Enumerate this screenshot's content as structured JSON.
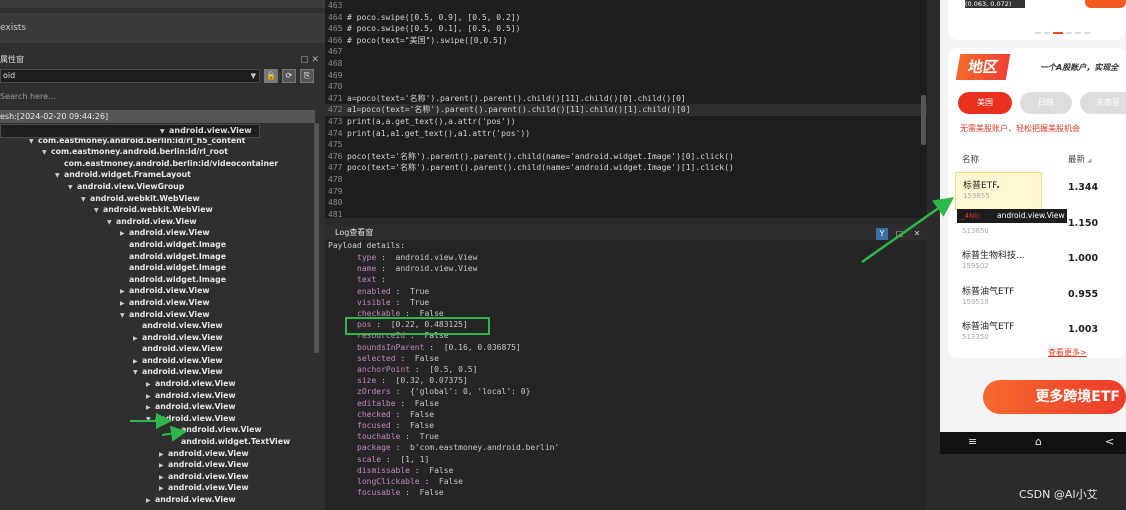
{
  "left": {
    "exists_label": "exists",
    "panel_title": "属性窗",
    "header_buttons": "▢ ✕",
    "device_select": "oid",
    "toolbar_buttons": [
      "🔒",
      "⟳",
      "⎘"
    ],
    "search_placeholder": "Search here...",
    "refresh_label": "esh:[2024-02-20 09:44:26]",
    "tree": [
      {
        "label": "android:id/content",
        "indent": 16,
        "expand": "open"
      },
      {
        "label": "com.eastmoney.android.berlin:id/rl_h5_content",
        "indent": 29,
        "expand": "open"
      },
      {
        "label": "com.eastmoney.android.berlin:id/rl_root",
        "indent": 42,
        "expand": "open"
      },
      {
        "label": "com.eastmoney.android.berlin:id/videocontainer",
        "indent": 55,
        "expand": "none"
      },
      {
        "label": "android.widget.FrameLayout",
        "indent": 55,
        "expand": "open"
      },
      {
        "label": "android.view.ViewGroup",
        "indent": 68,
        "expand": "open"
      },
      {
        "label": "android.webkit.WebView",
        "indent": 81,
        "expand": "open"
      },
      {
        "label": "android.webkit.WebView",
        "indent": 94,
        "expand": "open"
      },
      {
        "label": "android.view.View",
        "indent": 107,
        "expand": "open"
      },
      {
        "label": "android.view.View",
        "indent": 120,
        "expand": "closed"
      },
      {
        "label": "android.widget.Image",
        "indent": 120,
        "expand": "none"
      },
      {
        "label": "android.widget.Image",
        "indent": 120,
        "expand": "none"
      },
      {
        "label": "android.widget.Image",
        "indent": 120,
        "expand": "none"
      },
      {
        "label": "android.widget.Image",
        "indent": 120,
        "expand": "none"
      },
      {
        "label": "android.view.View",
        "indent": 120,
        "expand": "closed"
      },
      {
        "label": "android.view.View",
        "indent": 120,
        "expand": "closed"
      },
      {
        "label": "android.view.View",
        "indent": 120,
        "expand": "open"
      },
      {
        "label": "android.view.View",
        "indent": 133,
        "expand": "none"
      },
      {
        "label": "android.view.View",
        "indent": 133,
        "expand": "closed"
      },
      {
        "label": "android.view.View",
        "indent": 133,
        "expand": "none"
      },
      {
        "label": "android.view.View",
        "indent": 133,
        "expand": "closed"
      },
      {
        "label": "android.view.View",
        "indent": 133,
        "expand": "open"
      },
      {
        "label": "android.view.View",
        "indent": 146,
        "expand": "closed"
      },
      {
        "label": "android.view.View",
        "indent": 146,
        "expand": "closed"
      },
      {
        "label": "android.view.View",
        "indent": 146,
        "expand": "closed"
      },
      {
        "label": "android.view.View",
        "indent": 146,
        "expand": "open"
      },
      {
        "label": "android.view.View",
        "indent": 159,
        "expand": "open",
        "selected": true
      },
      {
        "label": "android.view.View",
        "indent": 172,
        "expand": "none"
      },
      {
        "label": "android.widget.TextView",
        "indent": 172,
        "expand": "none"
      },
      {
        "label": "android.view.View",
        "indent": 159,
        "expand": "closed"
      },
      {
        "label": "android.view.View",
        "indent": 159,
        "expand": "closed"
      },
      {
        "label": "android.view.View",
        "indent": 159,
        "expand": "closed"
      },
      {
        "label": "android.view.View",
        "indent": 159,
        "expand": "closed"
      },
      {
        "label": "android.view.View",
        "indent": 146,
        "expand": "closed"
      }
    ]
  },
  "code": {
    "lines": [
      {
        "n": "463",
        "t": ""
      },
      {
        "n": "464",
        "t": "# poco.swipe([0.5, 0.9], [0.5, 0.2])",
        "kind": "comment"
      },
      {
        "n": "465",
        "t": "# poco.swipe([0.5, 0.1], [0.5, 0.5])",
        "kind": "comment"
      },
      {
        "n": "466",
        "t": "# poco(text=\"美国\").swipe([0,0.5])",
        "kind": "comment"
      },
      {
        "n": "467",
        "t": ""
      },
      {
        "n": "468",
        "t": ""
      },
      {
        "n": "469",
        "t": ""
      },
      {
        "n": "470",
        "t": ""
      },
      {
        "n": "471",
        "t": "a=poco(text='名称').parent().parent().child()[11].child()[0].child()[0]"
      },
      {
        "n": "472",
        "t": "a1=poco(text='名称').parent().parent().child()[11].child()[1].child()[0]",
        "hl": true
      },
      {
        "n": "473",
        "t": "print(a,a.get_text(),a.attr('pos'))"
      },
      {
        "n": "474",
        "t": "print(a1,a1.get_text(),a1.attr('pos'))"
      },
      {
        "n": "475",
        "t": ""
      },
      {
        "n": "476",
        "t": "poco(text='名称').parent().parent().child(name='android.widget.Image')[0].click()"
      },
      {
        "n": "477",
        "t": "poco(text='名称').parent().parent().child(name='android.widget.Image')[1].click()"
      },
      {
        "n": "478",
        "t": ""
      },
      {
        "n": "479",
        "t": ""
      },
      {
        "n": "480",
        "t": ""
      },
      {
        "n": "481",
        "t": ""
      }
    ]
  },
  "log": {
    "title": "Log查看窗",
    "header_buttons": [
      "Y",
      "▢",
      "✕"
    ],
    "heading": "Payload details:",
    "rows": [
      {
        "k": "type",
        "v": "android.view.View"
      },
      {
        "k": "name",
        "v": "android.view.View"
      },
      {
        "k": "text",
        "v": ""
      },
      {
        "k": "enabled",
        "v": "True"
      },
      {
        "k": "visible",
        "v": "True"
      },
      {
        "k": "checkable",
        "v": "False"
      },
      {
        "k": "pos",
        "v": "[0.22, 0.483125]"
      },
      {
        "k": "resourceId",
        "v": "False"
      },
      {
        "k": "boundsInParent",
        "v": "[0.16, 0.036875]"
      },
      {
        "k": "selected",
        "v": "False"
      },
      {
        "k": "anchorPoint",
        "v": "[0.5, 0.5]"
      },
      {
        "k": "size",
        "v": "[0.32, 0.07375]"
      },
      {
        "k": "zOrders",
        "v": "{'global': 0, 'local': 0}"
      },
      {
        "k": "editalbe",
        "v": "False"
      },
      {
        "k": "checked",
        "v": "False"
      },
      {
        "k": "focused",
        "v": "False"
      },
      {
        "k": "touchable",
        "v": "True"
      },
      {
        "k": "package",
        "v": "b'com.eastmoney.android.berlin'"
      },
      {
        "k": "scale",
        "v": "[1, 1]"
      },
      {
        "k": "dismissable",
        "v": "False"
      },
      {
        "k": "longClickable",
        "v": "False"
      },
      {
        "k": "focusable",
        "v": "False"
      }
    ]
  },
  "phone": {
    "top_badge": "(0.063, 0.072)",
    "region_title": "地区",
    "tagline": "一个A股账户，实现全",
    "chips": [
      {
        "label": "美国",
        "active": true
      },
      {
        "label": "日韩",
        "active": false
      },
      {
        "label": "东南亚",
        "active": false
      }
    ],
    "promo": "无需美股账户，轻松把握美股机会",
    "col_name": "名称",
    "col_latest": "最新",
    "funds": [
      {
        "name": "标普ETF",
        "code": "159655",
        "price": "1.344"
      },
      {
        "name": "",
        "code": "513850",
        "price": "1.150"
      },
      {
        "name": "标普生物科技...",
        "code": "159502",
        "price": "1.000"
      },
      {
        "name": "标普油气ETF",
        "code": "159518",
        "price": "0.955"
      },
      {
        "name": "标普油气ETF",
        "code": "513350",
        "price": "1.003"
      }
    ],
    "see_more": "查看更多>",
    "tooltip_text": "android.view.View",
    "tooltip_red": "_4Nic",
    "cross_button": "更多跨境ETF",
    "nav_icons": [
      "≡",
      "⌂",
      "<"
    ]
  },
  "watermark": "CSDN @AI小艾",
  "colors": {
    "highlight_green": "#2fb84a",
    "brand_orange": "#f04a2a"
  }
}
